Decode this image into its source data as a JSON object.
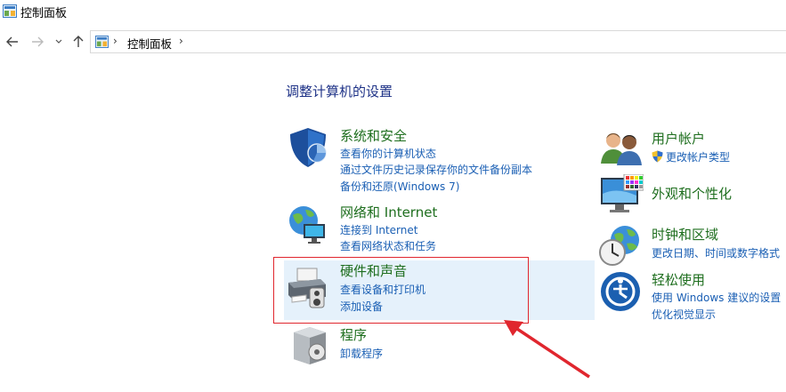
{
  "window": {
    "title": "控制面板"
  },
  "address": {
    "crumb": "控制面板",
    "separator": "›"
  },
  "heading": "调整计算机的设置",
  "categories": {
    "system": {
      "title": "系统和安全",
      "links": [
        "查看你的计算机状态",
        "通过文件历史记录保存你的文件备份副本",
        "备份和还原(Windows 7)"
      ]
    },
    "network": {
      "title": "网络和 Internet",
      "links": [
        "连接到 Internet",
        "查看网络状态和任务"
      ]
    },
    "hardware": {
      "title": "硬件和声音",
      "links": [
        "查看设备和打印机",
        "添加设备"
      ]
    },
    "programs": {
      "title": "程序",
      "links": [
        "卸载程序"
      ]
    },
    "users": {
      "title": "用户帐户",
      "links": [
        "更改帐户类型"
      ]
    },
    "appearance": {
      "title": "外观和个性化",
      "links": []
    },
    "clock": {
      "title": "时钟和区域",
      "links": [
        "更改日期、时间或数字格式"
      ]
    },
    "ease": {
      "title": "轻松使用",
      "links": [
        "使用 Windows 建议的设置",
        "优化视觉显示"
      ]
    }
  },
  "colors": {
    "category_title": "#1e6e1e",
    "link": "#1a5fb4",
    "heading": "#1e3287",
    "highlight": "#e5f1fb",
    "annotation": "#e0262e"
  },
  "icons": [
    "control-panel-icon",
    "back-arrow-icon",
    "forward-arrow-icon",
    "chevron-down-icon",
    "up-arrow-icon",
    "shield-icon",
    "globe-network-icon",
    "printer-icon",
    "programs-box-icon",
    "users-icon",
    "monitor-palette-icon",
    "clock-globe-icon",
    "ease-of-access-icon",
    "uac-shield-icon"
  ]
}
